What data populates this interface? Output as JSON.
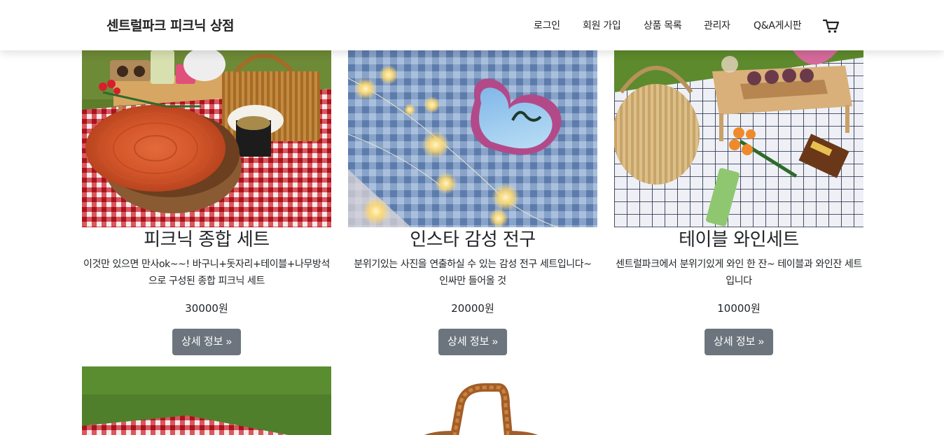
{
  "nav": {
    "brand": "센트럴파크 피크닉 상점",
    "links": [
      "로그인",
      "회원 가입",
      "상품 목록",
      "관리자",
      "Q&A게시판"
    ],
    "cart_icon": "cart-icon"
  },
  "products": [
    {
      "title": "피크닉 종합 세트",
      "description": "이것만 있으면 만사ok~~! 바구니+돗자리+테이블+나무방석으로 구성된 종합 피크닉 세트",
      "price": "30000원",
      "button": "상세 정보 »"
    },
    {
      "title": "인스타 감성 전구",
      "description": "분위기있는 사진을 연출하실 수 있는 감성 전구 세트입니다~ 인싸만 들어올 것",
      "price": "20000원",
      "button": "상세 정보 »"
    },
    {
      "title": "테이블 와인세트",
      "description": "센트럴파크에서 분위기있게 와인 한 잔~ 테이블과 와인잔 세트입니다",
      "price": "10000원",
      "button": "상세 정보 »"
    }
  ],
  "colors": {
    "button_bg": "#6c757d",
    "gingham_red": "#c8202a",
    "grass": "#4f7a2a",
    "blue_check": "#7a9bc2"
  }
}
